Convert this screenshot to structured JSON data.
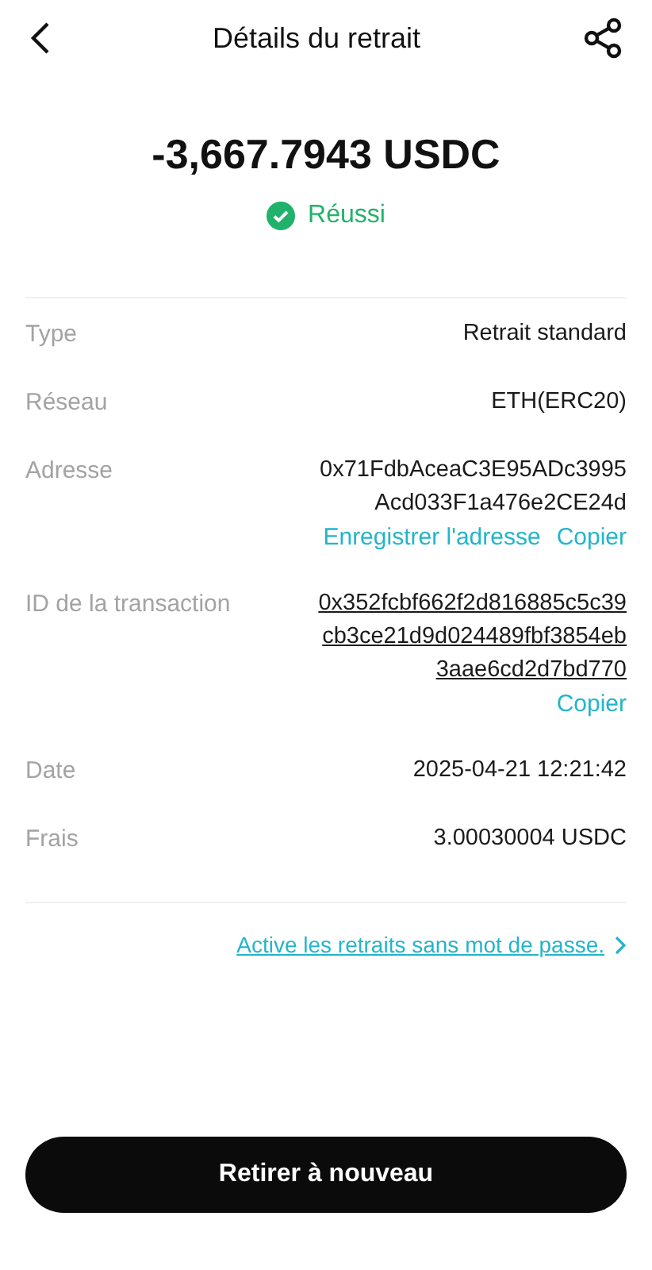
{
  "header": {
    "title": "Détails du retrait"
  },
  "amount": "-3,667.7943 USDC",
  "status": {
    "label": "Réussi",
    "success": true
  },
  "rows": [
    {
      "kind": "plain",
      "label": "Type",
      "lines": [
        "Retrait standard"
      ]
    },
    {
      "kind": "plain",
      "label": "Réseau",
      "lines": [
        "ETH(ERC20)"
      ]
    },
    {
      "kind": "plain",
      "label": "Adresse",
      "lines": [
        "0x71FdbAceaC3E95ADc3995",
        "Acd033F1a476e2CE24d"
      ],
      "actions": [
        "Enregistrer l'adresse",
        "Copier"
      ]
    },
    {
      "kind": "link",
      "label": "ID de la transaction",
      "lines": [
        "0x352fcbf662f2d816885c5c39",
        "cb3ce21d9d024489fbf3854eb",
        "3aae6cd2d7bd770"
      ],
      "actions": [
        "Copier"
      ]
    },
    {
      "kind": "plain",
      "label": "Date",
      "lines": [
        "2025-04-21 12:21:42"
      ]
    },
    {
      "kind": "plain",
      "label": "Frais",
      "lines": [
        "3.00030004 USDC"
      ]
    }
  ],
  "promo_link": "Active les retraits sans mot de passe.",
  "primary_button": "Retirer à nouveau"
}
